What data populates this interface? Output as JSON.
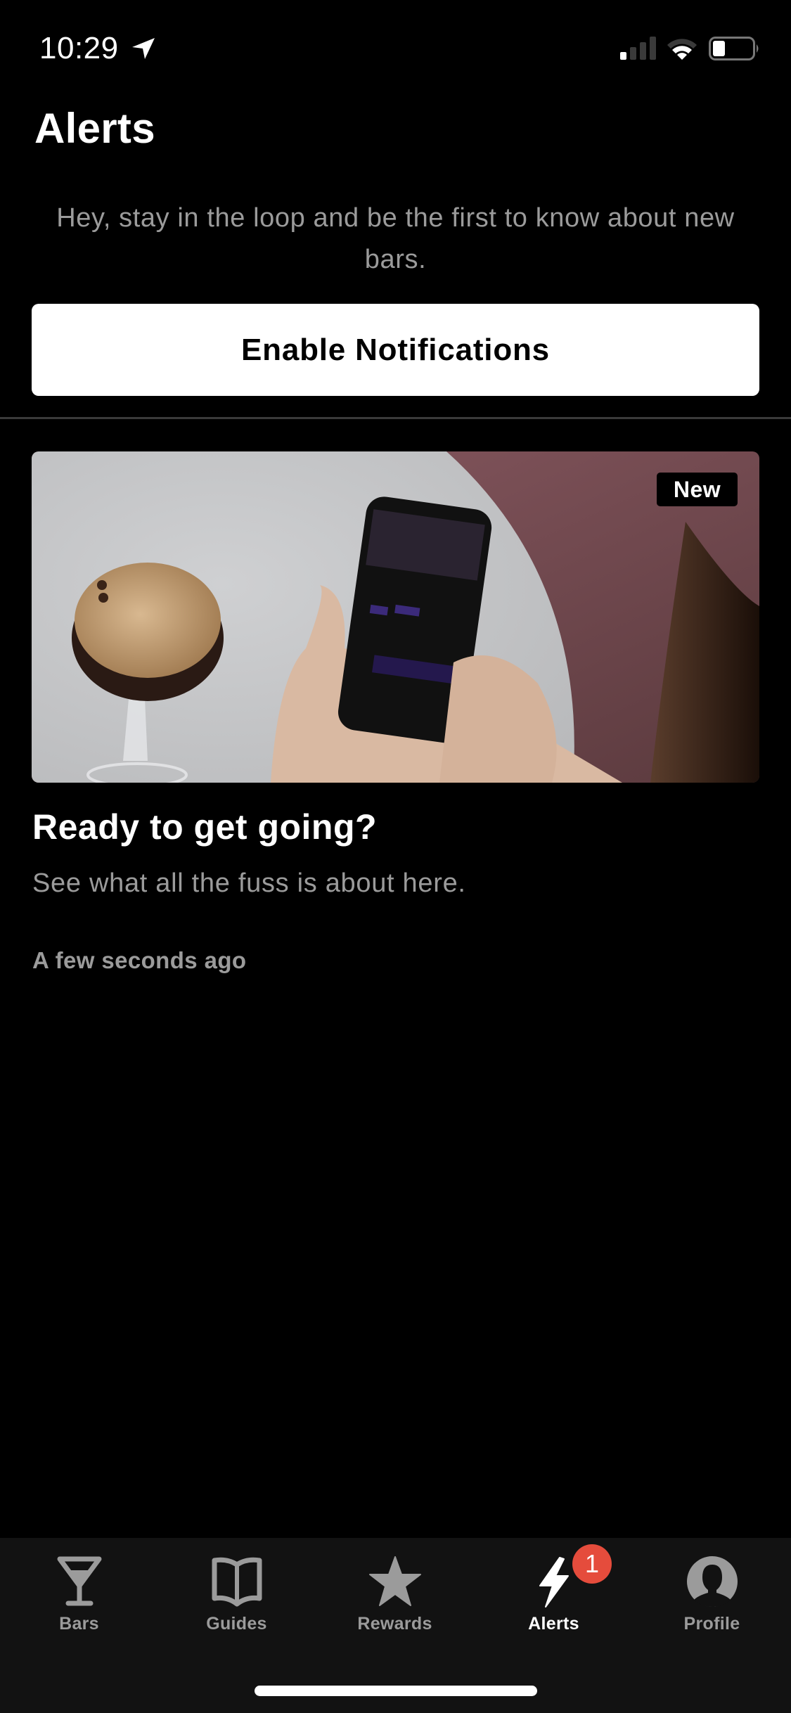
{
  "status_bar": {
    "time": "10:29",
    "location_icon": "location-arrow-icon",
    "signal_bars_active": 1,
    "signal_bars_total": 4,
    "wifi_icon": "wifi-icon",
    "battery_level_percent": 30
  },
  "header": {
    "title": "Alerts"
  },
  "notifications_prompt": {
    "text": "Hey, stay in the loop and be the first to know about new bars.",
    "button_label": "Enable Notifications"
  },
  "alerts": [
    {
      "image_description": "Hands holding a phone showing a bar filter app beside an espresso martini on a marble table",
      "badge": "New",
      "title": "Ready to get going?",
      "subtitle": "See what all the fuss is about here.",
      "time": "A few seconds ago"
    }
  ],
  "tab_bar": {
    "items": [
      {
        "label": "Bars",
        "icon": "cocktail-glass-icon",
        "active": false
      },
      {
        "label": "Guides",
        "icon": "open-book-icon",
        "active": false
      },
      {
        "label": "Rewards",
        "icon": "star-icon",
        "active": false
      },
      {
        "label": "Alerts",
        "icon": "lightning-bolt-icon",
        "active": true,
        "badge": "1"
      },
      {
        "label": "Profile",
        "icon": "user-profile-icon",
        "active": false
      }
    ]
  },
  "colors": {
    "background": "#000000",
    "secondary_text": "#9b9b9b",
    "tab_bar_background": "#121212",
    "badge_red": "#e54c3c",
    "divider": "#3a3a3a"
  }
}
